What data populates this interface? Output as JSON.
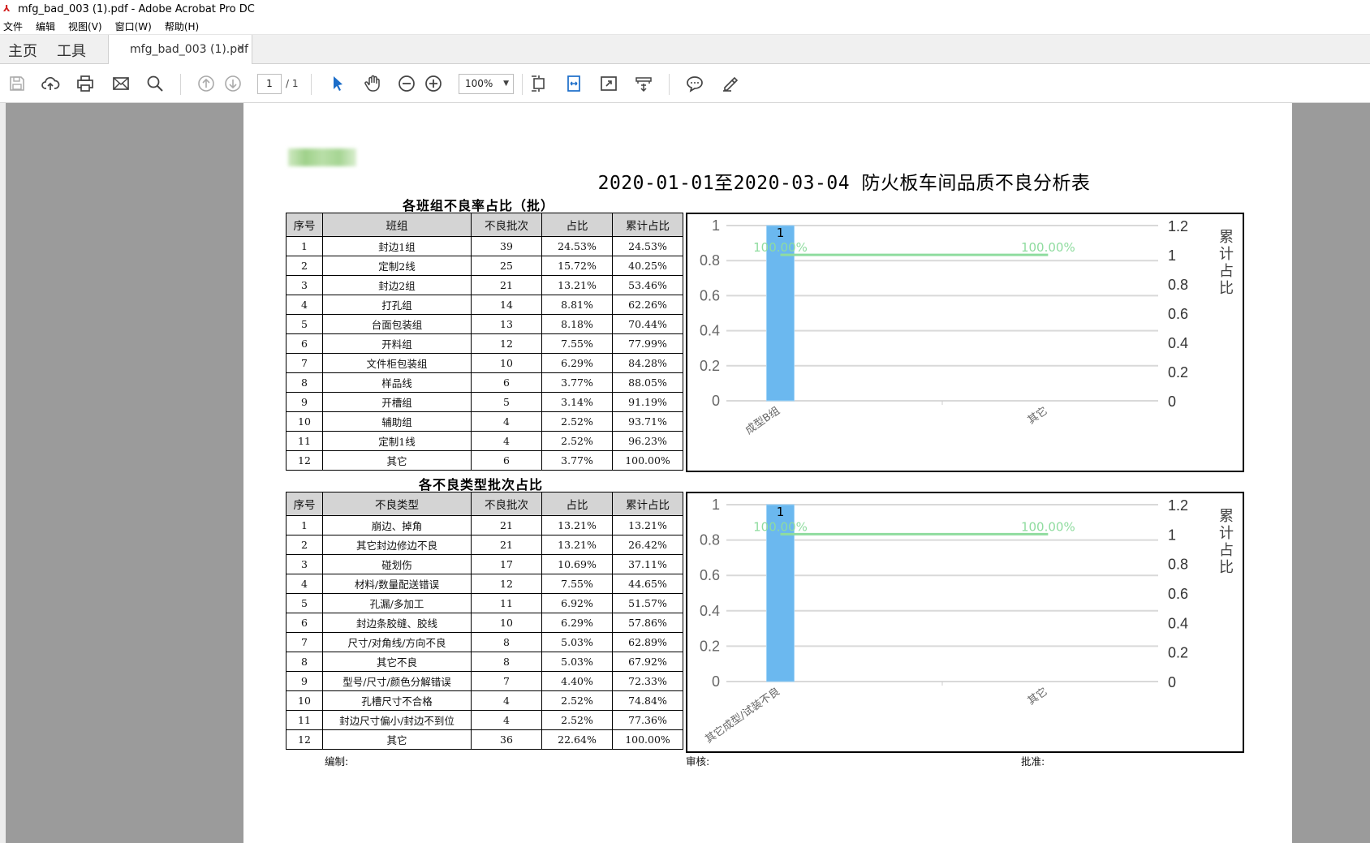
{
  "window": {
    "title": "mfg_bad_003 (1).pdf - Adobe Acrobat Pro DC"
  },
  "menu": [
    "文件",
    "编辑",
    "视图(V)",
    "窗口(W)",
    "帮助(H)"
  ],
  "nav": {
    "home": "主页",
    "tools": "工具"
  },
  "tab": {
    "label": "mfg_bad_003 (1).pdf",
    "close": "×"
  },
  "toolbar": {
    "page_current": "1",
    "page_total": "/ 1",
    "zoom": "100%"
  },
  "document": {
    "title": "2020-01-01至2020-03-04 防火板车间品质不良分析表",
    "section1_title": "各班组不良率占比（批）",
    "section2_title": "各不良类型批次占比",
    "footer": {
      "prepared": "编制:",
      "review": "审核:",
      "approve": "批准:"
    }
  },
  "table1": {
    "headers": [
      "序号",
      "班组",
      "不良批次",
      "占比",
      "累计占比"
    ],
    "rows": [
      [
        "1",
        "封边1组",
        "39",
        "24.53%",
        "24.53%"
      ],
      [
        "2",
        "定制2线",
        "25",
        "15.72%",
        "40.25%"
      ],
      [
        "3",
        "封边2组",
        "21",
        "13.21%",
        "53.46%"
      ],
      [
        "4",
        "打孔组",
        "14",
        "8.81%",
        "62.26%"
      ],
      [
        "5",
        "台面包装组",
        "13",
        "8.18%",
        "70.44%"
      ],
      [
        "6",
        "开料组",
        "12",
        "7.55%",
        "77.99%"
      ],
      [
        "7",
        "文件柜包装组",
        "10",
        "6.29%",
        "84.28%"
      ],
      [
        "8",
        "样品线",
        "6",
        "3.77%",
        "88.05%"
      ],
      [
        "9",
        "开槽组",
        "5",
        "3.14%",
        "91.19%"
      ],
      [
        "10",
        "辅助组",
        "4",
        "2.52%",
        "93.71%"
      ],
      [
        "11",
        "定制1线",
        "4",
        "2.52%",
        "96.23%"
      ],
      [
        "12",
        "其它",
        "6",
        "3.77%",
        "100.00%"
      ]
    ]
  },
  "table2": {
    "headers": [
      "序号",
      "不良类型",
      "不良批次",
      "占比",
      "累计占比"
    ],
    "rows": [
      [
        "1",
        "崩边、掉角",
        "21",
        "13.21%",
        "13.21%"
      ],
      [
        "2",
        "其它封边修边不良",
        "21",
        "13.21%",
        "26.42%"
      ],
      [
        "3",
        "碰划伤",
        "17",
        "10.69%",
        "37.11%"
      ],
      [
        "4",
        "材料/数量配送错误",
        "12",
        "7.55%",
        "44.65%"
      ],
      [
        "5",
        "孔漏/多加工",
        "11",
        "6.92%",
        "51.57%"
      ],
      [
        "6",
        "封边条胶缝、胶线",
        "10",
        "6.29%",
        "57.86%"
      ],
      [
        "7",
        "尺寸/对角线/方向不良",
        "8",
        "5.03%",
        "62.89%"
      ],
      [
        "8",
        "其它不良",
        "8",
        "5.03%",
        "67.92%"
      ],
      [
        "9",
        "型号/尺寸/颜色分解错误",
        "7",
        "4.40%",
        "72.33%"
      ],
      [
        "10",
        "孔槽尺寸不合格",
        "4",
        "2.52%",
        "74.84%"
      ],
      [
        "11",
        "封边尺寸偏小/封边不到位",
        "4",
        "2.52%",
        "77.36%"
      ],
      [
        "12",
        "其它",
        "36",
        "22.64%",
        "100.00%"
      ]
    ]
  },
  "chart_data": [
    {
      "type": "bar",
      "categories": [
        "成型B组",
        "其它"
      ],
      "values": [
        1,
        0
      ],
      "data_labels": [
        "1",
        ""
      ],
      "line_series": {
        "values": [
          1.0,
          1.0
        ],
        "labels": [
          "100.00%",
          "100.00%"
        ]
      },
      "ylim": [
        0,
        1
      ],
      "y_ticks": [
        "0",
        "0.2",
        "0.4",
        "0.6",
        "0.8",
        "1"
      ],
      "y2lim": [
        0,
        1.2
      ],
      "y2_ticks": [
        "0",
        "0.2",
        "0.4",
        "0.6",
        "0.8",
        "1",
        "1.2"
      ],
      "y2label": "累计占比",
      "grid": true,
      "colors": {
        "bar": "#6bb8ef",
        "line": "#8fdc9f"
      }
    },
    {
      "type": "bar",
      "categories": [
        "其它成型/试装不良",
        "其它"
      ],
      "values": [
        1,
        0
      ],
      "data_labels": [
        "1",
        ""
      ],
      "line_series": {
        "values": [
          1.0,
          1.0
        ],
        "labels": [
          "100.00%",
          "100.00%"
        ]
      },
      "ylim": [
        0,
        1
      ],
      "y_ticks": [
        "0",
        "0.2",
        "0.4",
        "0.6",
        "0.8",
        "1"
      ],
      "y2lim": [
        0,
        1.2
      ],
      "y2_ticks": [
        "0",
        "0.2",
        "0.4",
        "0.6",
        "0.8",
        "1",
        "1.2"
      ],
      "y2label": "累计占比",
      "grid": true,
      "colors": {
        "bar": "#6bb8ef",
        "line": "#8fdc9f"
      }
    }
  ]
}
